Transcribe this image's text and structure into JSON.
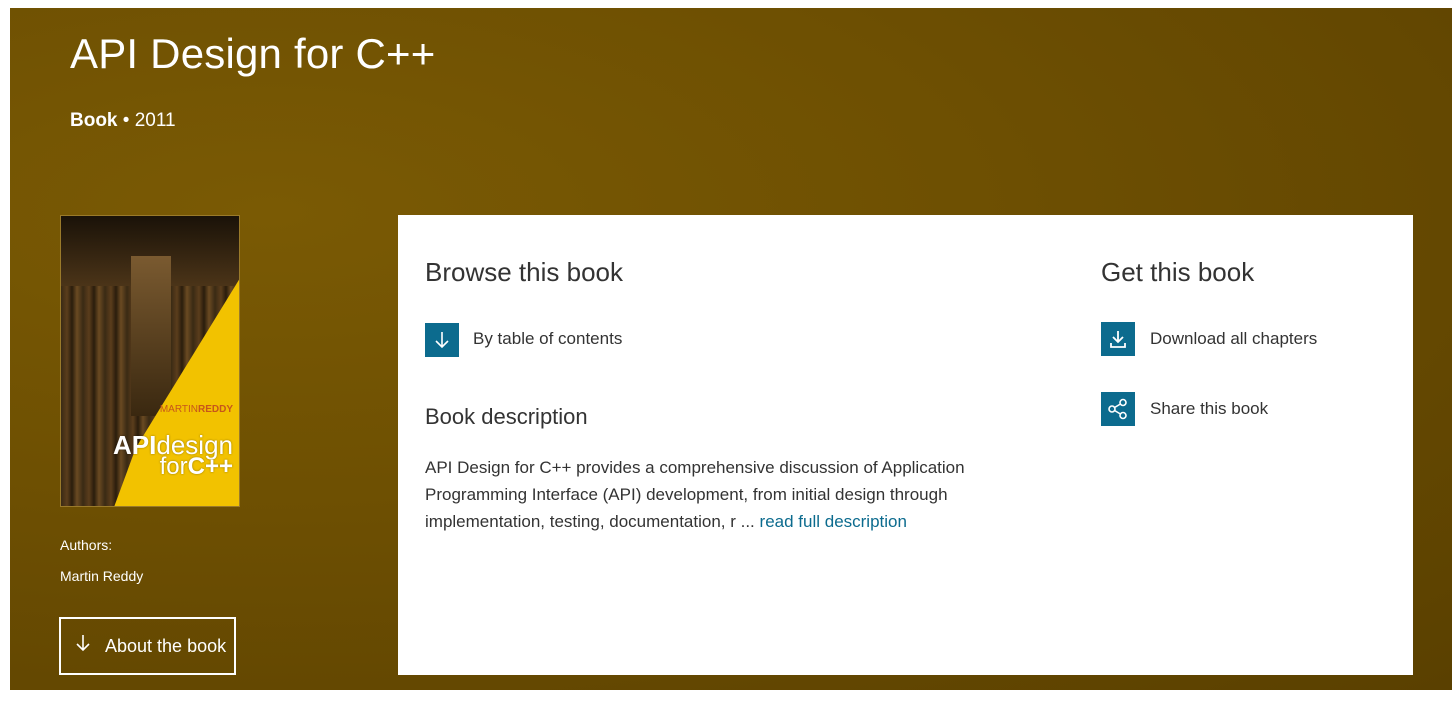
{
  "hero": {
    "title": "API Design for C++",
    "type": "Book",
    "separator": " • ",
    "year": "2011"
  },
  "cover": {
    "author_first": "MARTIN",
    "author_last": "REDDY",
    "title_api": "API",
    "title_design": "design",
    "title_for": "for",
    "title_cpp": "C++"
  },
  "authors": {
    "label": "Authors:",
    "name": "Martin Reddy"
  },
  "about_button": {
    "label": "About the book",
    "icon": "arrow-down-icon"
  },
  "browse": {
    "heading": "Browse this book",
    "toc_label": "By table of contents",
    "toc_icon": "arrow-down-icon"
  },
  "description": {
    "heading": "Book description",
    "text": "API Design for C++ provides a comprehensive discussion of Application Programming Interface (API) development, from initial design through implementation, testing, documentation, r ...",
    "more_link": "read full description"
  },
  "get": {
    "heading": "Get this book",
    "download_label": "Download all chapters",
    "download_icon": "download-icon",
    "share_label": "Share this book",
    "share_icon": "share-icon"
  },
  "colors": {
    "hero_background": "#6d4f02",
    "accent": "#0c6b8e",
    "cover_yellow": "#f2c200"
  }
}
